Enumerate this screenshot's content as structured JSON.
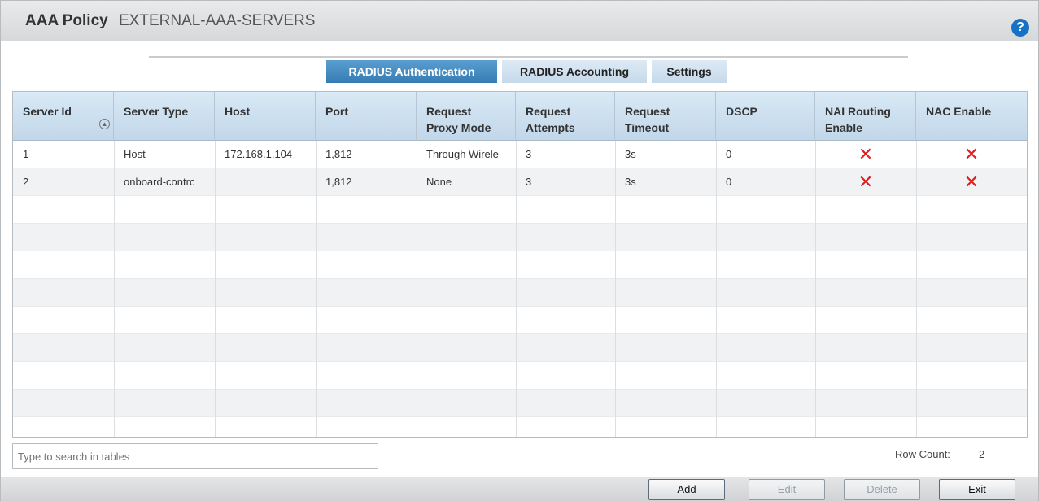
{
  "header": {
    "title": "AAA Policy",
    "policy_name": "EXTERNAL-AAA-SERVERS",
    "help_icon": "?"
  },
  "tabs": [
    {
      "label": "RADIUS Authentication",
      "active": true
    },
    {
      "label": "RADIUS Accounting",
      "active": false
    },
    {
      "label": "Settings",
      "active": false
    }
  ],
  "table": {
    "columns": [
      {
        "label": "Server Id",
        "line2": ""
      },
      {
        "label": "Server Type",
        "line2": ""
      },
      {
        "label": "Host",
        "line2": ""
      },
      {
        "label": "Port",
        "line2": ""
      },
      {
        "label": "Request",
        "line2": "Proxy Mode"
      },
      {
        "label": "Request",
        "line2": "Attempts"
      },
      {
        "label": "Request",
        "line2": "Timeout"
      },
      {
        "label": "DSCP",
        "line2": ""
      },
      {
        "label": "NAI Routing",
        "line2": "Enable"
      },
      {
        "label": "NAC Enable",
        "line2": ""
      }
    ],
    "sort_icon": "sort-ascending-icon",
    "rows": [
      {
        "server_id": "1",
        "server_type": "Host",
        "host": "172.168.1.104",
        "port": "1,812",
        "request_proxy_mode": "Through Wirele",
        "request_attempts": "3",
        "request_timeout": "3s",
        "dscp": "0",
        "nai_routing_enable": false,
        "nac_enable": false
      },
      {
        "server_id": "2",
        "server_type": "onboard-contrc",
        "host": "",
        "port": "1,812",
        "request_proxy_mode": "None",
        "request_attempts": "3",
        "request_timeout": "3s",
        "dscp": "0",
        "nai_routing_enable": false,
        "nac_enable": false
      }
    ],
    "disabled_symbol": "✕"
  },
  "footer": {
    "search_placeholder": "Type to search in tables",
    "row_count_label": "Row Count:",
    "row_count_value": "2"
  },
  "buttons": {
    "add": "Add",
    "edit": "Edit",
    "delete": "Delete",
    "exit": "Exit"
  },
  "colors": {
    "accent": "#357cb4",
    "disabled_x": "#e21d1d",
    "help": "#1672c6"
  }
}
